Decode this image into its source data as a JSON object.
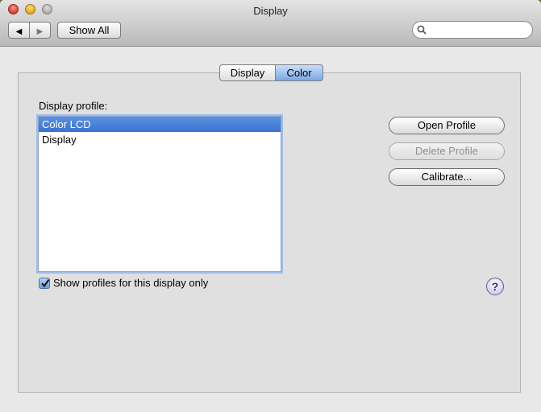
{
  "window": {
    "title": "Display"
  },
  "toolbar": {
    "back_glyph": "◀",
    "forward_glyph": "▶",
    "show_all_label": "Show All",
    "search": {
      "placeholder": "",
      "value": ""
    }
  },
  "tabs": [
    {
      "label": "Display",
      "selected": false
    },
    {
      "label": "Color",
      "selected": true
    }
  ],
  "profiles": {
    "label": "Display profile:",
    "items": [
      {
        "label": "Color LCD",
        "selected": true
      },
      {
        "label": "Display",
        "selected": false
      }
    ]
  },
  "buttons": {
    "open_profile": "Open Profile",
    "delete_profile": "Delete Profile",
    "calibrate": "Calibrate..."
  },
  "checkbox": {
    "label": "Show profiles for this display only",
    "checked": true
  },
  "help": {
    "glyph": "?"
  },
  "colors": {
    "selection": "#3a72d0",
    "tab_selected": "#7aa7e4",
    "panel_bg": "#e0e0e0"
  }
}
